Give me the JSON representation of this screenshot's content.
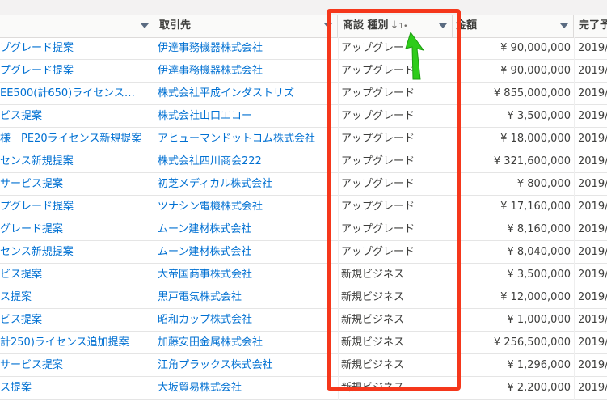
{
  "columns": [
    {
      "label": ""
    },
    {
      "label": "取引先"
    },
    {
      "label": "商談 種別",
      "sort_arrow": "↓",
      "sort_index": "1",
      "sort_marker": "•"
    },
    {
      "label": "金額"
    },
    {
      "label": "完了予"
    }
  ],
  "rows": [
    {
      "name": "プグレード提案",
      "account": "伊達事務機器株式会社",
      "type": "アップグレー",
      "amount": "¥ 90,000,000",
      "date": "2019/"
    },
    {
      "name": "プグレード提案",
      "account": "伊達事務機器株式会社",
      "type": "アップグレード",
      "amount": "¥ 90,000,000",
      "date": "2019/"
    },
    {
      "name": "EE500(計650)ライセンス…",
      "account": "株式会社平成インダストリズ",
      "type": "アップグレード",
      "amount": "¥ 855,000,000",
      "date": "2019/"
    },
    {
      "name": "ビス提案",
      "account": "株式会社山口エコー",
      "type": "アップグレード",
      "amount": "¥ 3,500,000",
      "date": "2019/"
    },
    {
      "name": "様　PE20ライセンス新規提案",
      "account": "アヒューマンドットコム株式会社",
      "type": "アップグレード",
      "amount": "¥ 18,000,000",
      "date": "2019/"
    },
    {
      "name": "センス新規提案",
      "account": "株式会社四川商会222",
      "type": "アップグレード",
      "amount": "¥ 321,600,000",
      "date": "2019/"
    },
    {
      "name": "サービス提案",
      "account": "初芝メディカル株式会社",
      "type": "アップグレード",
      "amount": "¥ 800,000",
      "date": "2019/"
    },
    {
      "name": "プグレード提案",
      "account": "ツナシン電機株式会社",
      "type": "アップグレード",
      "amount": "¥ 17,160,000",
      "date": "2019/"
    },
    {
      "name": "グレード提案",
      "account": "ムーン建材株式会社",
      "type": "アップグレード",
      "amount": "¥ 8,160,000",
      "date": "2019/"
    },
    {
      "name": "センス新規提案",
      "account": "ムーン建材株式会社",
      "type": "アップグレード",
      "amount": "¥ 8,040,000",
      "date": "2019/"
    },
    {
      "name": "ビス提案",
      "account": "大帝国商事株式会社",
      "type": "新規ビジネス",
      "amount": "¥ 3,500,000",
      "date": "2019/"
    },
    {
      "name": "ス提案",
      "account": "黒戸電気株式会社",
      "type": "新規ビジネス",
      "amount": "¥ 12,000,000",
      "date": "2019/"
    },
    {
      "name": "ビス提案",
      "account": "昭和カップ株式会社",
      "type": "新規ビジネス",
      "amount": "¥ 1,000,000",
      "date": "2019/"
    },
    {
      "name": "計250)ライセンス追加提案",
      "account": "加藤安田金属株式会社",
      "type": "新規ビジネス",
      "amount": "¥ 256,500,000",
      "date": "2019/"
    },
    {
      "name": "サービス提案",
      "account": "江角プラックス株式会社",
      "type": "新規ビジネス",
      "amount": "¥ 1,296,000",
      "date": "2019/"
    },
    {
      "name": "ス提案",
      "account": "大坂貿易株式会社",
      "type": "新規ビジネス",
      "amount": "¥ 2,200,000",
      "date": "2019/"
    }
  ],
  "colors": {
    "highlight_box": "#f5371b",
    "pointer_arrow": "#2ecc1a",
    "link": "#0070d2"
  }
}
